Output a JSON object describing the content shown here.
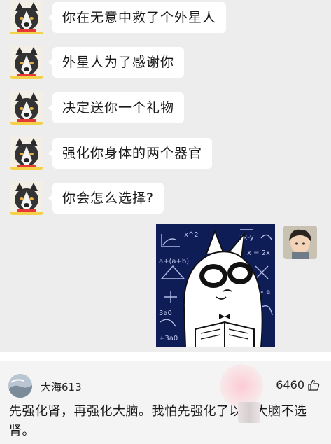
{
  "messages": [
    {
      "text": "你在无意中救了个外星人"
    },
    {
      "text": "外星人为了感谢你"
    },
    {
      "text": "决定送你一个礼物"
    },
    {
      "text": "强化你身体的两个器官"
    },
    {
      "text": "你会怎么选择?"
    }
  ],
  "sticker": {
    "formulas": [
      "2x-y",
      "x = 2x",
      "a+(a+b)",
      "3a0",
      "+3a0",
      "2 > a",
      "x^2"
    ]
  },
  "comment": {
    "username": "大海613",
    "likes": "6460",
    "text": "先强化肾，再强化大脑。我怕先强化了以后大脑不选肾。"
  },
  "colors": {
    "chat_background": "#ededed",
    "bubble": "#ffffff",
    "sticker_background": "#0f1d57",
    "comment_background": "#f4f4f4"
  }
}
